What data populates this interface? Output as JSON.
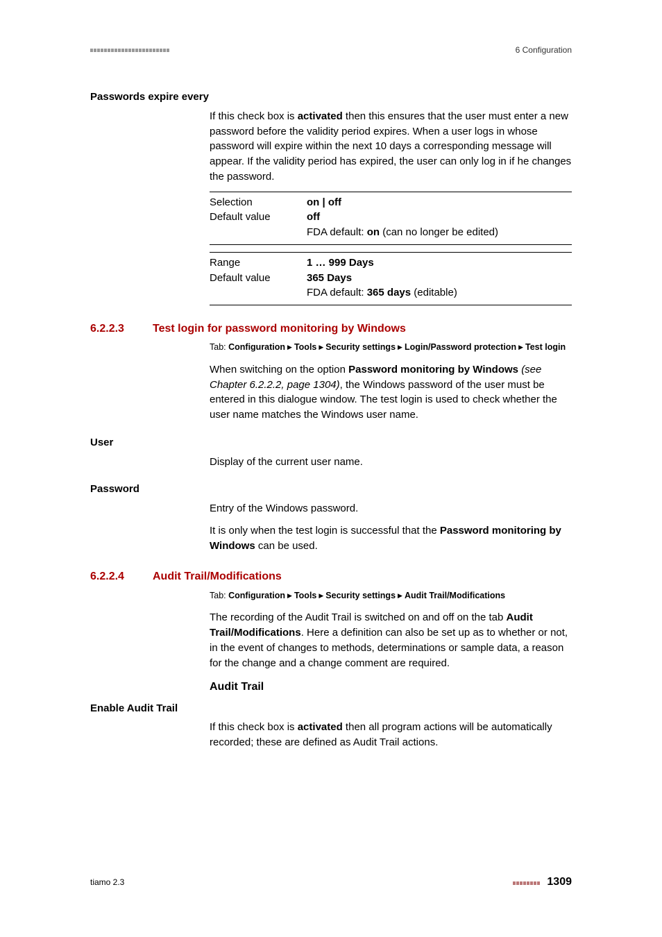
{
  "header": {
    "right": "6 Configuration"
  },
  "s1": {
    "label": "Passwords expire every",
    "body_parts": [
      "If this check box is ",
      " then this ensures that the user must enter a new password before the validity period expires. When a user logs in whose password will expire within the next 10 days a corresponding message will appear. If the validity period has expired, the user can only log in if he changes the password."
    ],
    "body_bold": "activated",
    "t1": {
      "r1_label": "Selection",
      "r1_value": "on | off",
      "r2_label": "Default value",
      "r2_value": "off",
      "r3_prefix": "FDA default: ",
      "r3_bold": "on",
      "r3_suffix": " (can no longer be edited)"
    },
    "t2": {
      "r1_label": "Range",
      "r1_value": "1 … 999 Days",
      "r2_label": "Default value",
      "r2_value": "365 Days",
      "r3_prefix": "FDA default: ",
      "r3_bold": "365 days",
      "r3_suffix": " (editable)"
    }
  },
  "s2": {
    "num": "6.2.2.3",
    "title": "Test login for password monitoring by Windows",
    "tab_prefix": "Tab: ",
    "tab_parts": [
      "Configuration",
      "Tools",
      "Security settings",
      "Login/Password protection",
      "Test login"
    ],
    "p1_a": "When switching on the option ",
    "p1_b": "Password monitoring by Windows",
    "p1_c": " ",
    "p1_italic": "(see Chapter 6.2.2.2, page 1304)",
    "p1_d": ", the Windows password of the user must be entered in this dialogue window. The test login is used to check whether the user name matches the Windows user name.",
    "user_label": "User",
    "user_body": "Display of the current user name.",
    "pwd_label": "Password",
    "pwd_body1": "Entry of the Windows password.",
    "pwd_body2_a": "It is only when the test login is successful that the ",
    "pwd_body2_b": "Password monitoring by Windows",
    "pwd_body2_c": " can be used."
  },
  "s3": {
    "num": "6.2.2.4",
    "title": "Audit Trail/Modifications",
    "tab_prefix": "Tab: ",
    "tab_parts": [
      "Configuration",
      "Tools",
      "Security settings",
      "Audit Trail/Modifications"
    ],
    "p1_a": "The recording of the Audit Trail is switched on and off on the tab ",
    "p1_b": "Audit Trail/Modifications",
    "p1_c": ". Here a definition can also be set up as to whether or not, in the event of changes to methods, determinations or sample data, a reason for the change and a change comment are required.",
    "subhead": "Audit Trail",
    "enable_label": "Enable Audit Trail",
    "enable_a": "If this check box is ",
    "enable_b": "activated",
    "enable_c": " then all program actions will be automatically recorded; these are defined as Audit Trail actions."
  },
  "footer": {
    "left": "tiamo 2.3",
    "page": "1309"
  }
}
